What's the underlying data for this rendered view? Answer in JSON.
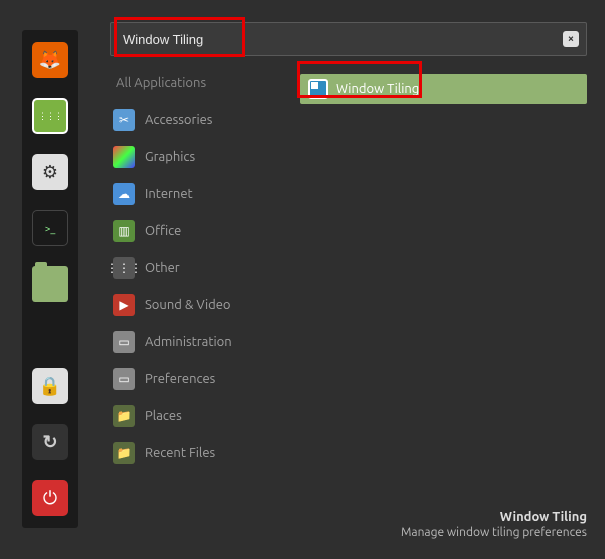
{
  "search": {
    "value": "Window Tiling"
  },
  "sidebar": [
    {
      "name": "firefox-icon",
      "bg": "#e66000",
      "glyph": "🦊"
    },
    {
      "name": "apps-icon",
      "bg": "#7cb342",
      "glyph": "⋮⋮⋮"
    },
    {
      "name": "settings-icon",
      "bg": "#e0e0e0",
      "glyph": "⚙"
    },
    {
      "name": "terminal-icon",
      "bg": "#1a1a1a",
      "glyph": ">_"
    },
    {
      "name": "files-icon",
      "bg": "#92b372",
      "glyph": "📁"
    },
    {
      "name": "lock-icon",
      "bg": "#e0e0e0",
      "glyph": "🔒"
    },
    {
      "name": "logout-icon",
      "bg": "#333",
      "glyph": "↻"
    },
    {
      "name": "power-icon",
      "bg": "#d32f2f",
      "glyph": "⏻"
    }
  ],
  "categories": [
    {
      "label": "All Applications",
      "name": "cat-all",
      "icon_bg": "",
      "glyph": "",
      "first": true
    },
    {
      "label": "Accessories",
      "name": "cat-accessories",
      "icon_bg": "#5b9bd5",
      "glyph": "✂"
    },
    {
      "label": "Graphics",
      "name": "cat-graphics",
      "icon_bg": "linear-gradient(135deg,#f44,#4f4,#44f)",
      "glyph": ""
    },
    {
      "label": "Internet",
      "name": "cat-internet",
      "icon_bg": "#4a90d9",
      "glyph": "☁"
    },
    {
      "label": "Office",
      "name": "cat-office",
      "icon_bg": "#5a8f3c",
      "glyph": "▥"
    },
    {
      "label": "Other",
      "name": "cat-other",
      "icon_bg": "#555",
      "glyph": "⋮⋮⋮"
    },
    {
      "label": "Sound & Video",
      "name": "cat-sound-video",
      "icon_bg": "#c0392b",
      "glyph": "▶"
    },
    {
      "label": "Administration",
      "name": "cat-administration",
      "icon_bg": "#888",
      "glyph": "▭"
    },
    {
      "label": "Preferences",
      "name": "cat-preferences",
      "icon_bg": "#888",
      "glyph": "▭"
    },
    {
      "label": "Places",
      "name": "cat-places",
      "icon_bg": "#5a6b3e",
      "glyph": "📁"
    },
    {
      "label": "Recent Files",
      "name": "cat-recent",
      "icon_bg": "#5a6b3e",
      "glyph": "📁"
    }
  ],
  "results": [
    {
      "label": "Window Tiling",
      "name": "result-window-tiling"
    }
  ],
  "tooltip": {
    "title": "Window Tiling",
    "desc": "Manage window tiling preferences"
  }
}
